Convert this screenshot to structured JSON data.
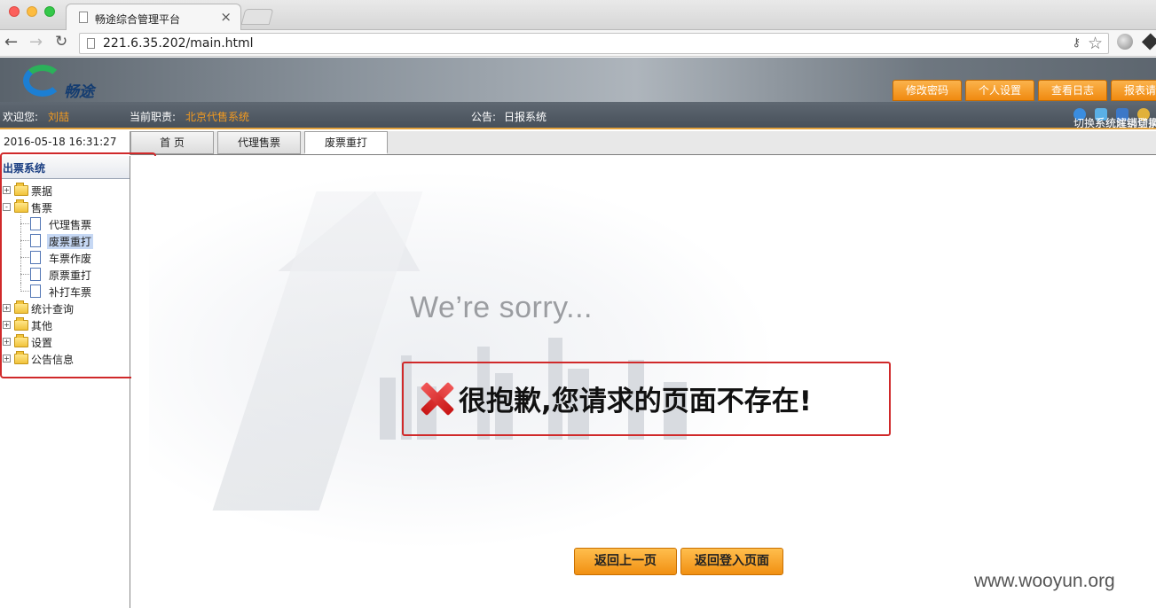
{
  "browser": {
    "tab_title": "畅途综合管理平台",
    "tab_close": "×",
    "url": "221.6.35.202/main.html"
  },
  "header": {
    "logo_text": "畅途",
    "buttons": [
      "修改密码",
      "个人设置",
      "查看日志",
      "报表请求"
    ]
  },
  "info_bar": {
    "welcome_label": "欢迎您:",
    "user_name": "刘喆",
    "role_label": "当前职责:",
    "role_name": "北京代售系统",
    "notice_label": "公告:",
    "notice_text": "日报系统",
    "links": [
      {
        "label": "切换系统",
        "icon": "switch-icon"
      },
      {
        "label": "系统解绑",
        "icon": "unlock-user-icon"
      },
      {
        "label": "注销登录",
        "icon": "monitor-logout-icon"
      },
      {
        "label": "切换职责",
        "icon": "role-switch-icon"
      }
    ]
  },
  "datetime": "2016-05-18 16:31:27",
  "page_tabs": [
    {
      "label": "首 页",
      "active": false
    },
    {
      "label": "代理售票",
      "active": false
    },
    {
      "label": "废票重打",
      "active": true
    }
  ],
  "sidebar": {
    "title": "出票系统",
    "tree": [
      {
        "label": "票据",
        "expander": "+",
        "type": "folder"
      },
      {
        "label": "售票",
        "expander": "-",
        "type": "folder"
      },
      {
        "label": "代理售票",
        "type": "leaf"
      },
      {
        "label": "废票重打",
        "type": "leaf",
        "selected": true
      },
      {
        "label": "车票作废",
        "type": "leaf"
      },
      {
        "label": "原票重打",
        "type": "leaf"
      },
      {
        "label": "补打车票",
        "type": "leaf"
      },
      {
        "label": "统计查询",
        "expander": "+",
        "type": "folder"
      },
      {
        "label": "其他",
        "expander": "+",
        "type": "folder"
      },
      {
        "label": "设置",
        "expander": "+",
        "type": "folder"
      },
      {
        "label": "公告信息",
        "expander": "+",
        "type": "folder"
      }
    ]
  },
  "main": {
    "sorry_text": "We’re  sorry...",
    "error_message": "很抱歉,您请求的页面不存在!",
    "back_button": "返回上一页",
    "login_button": "返回登入页面",
    "watermark": "www.wooyun.org"
  },
  "colors": {
    "accent_orange": "#f39a1f",
    "annotation_red": "#d0292a"
  }
}
